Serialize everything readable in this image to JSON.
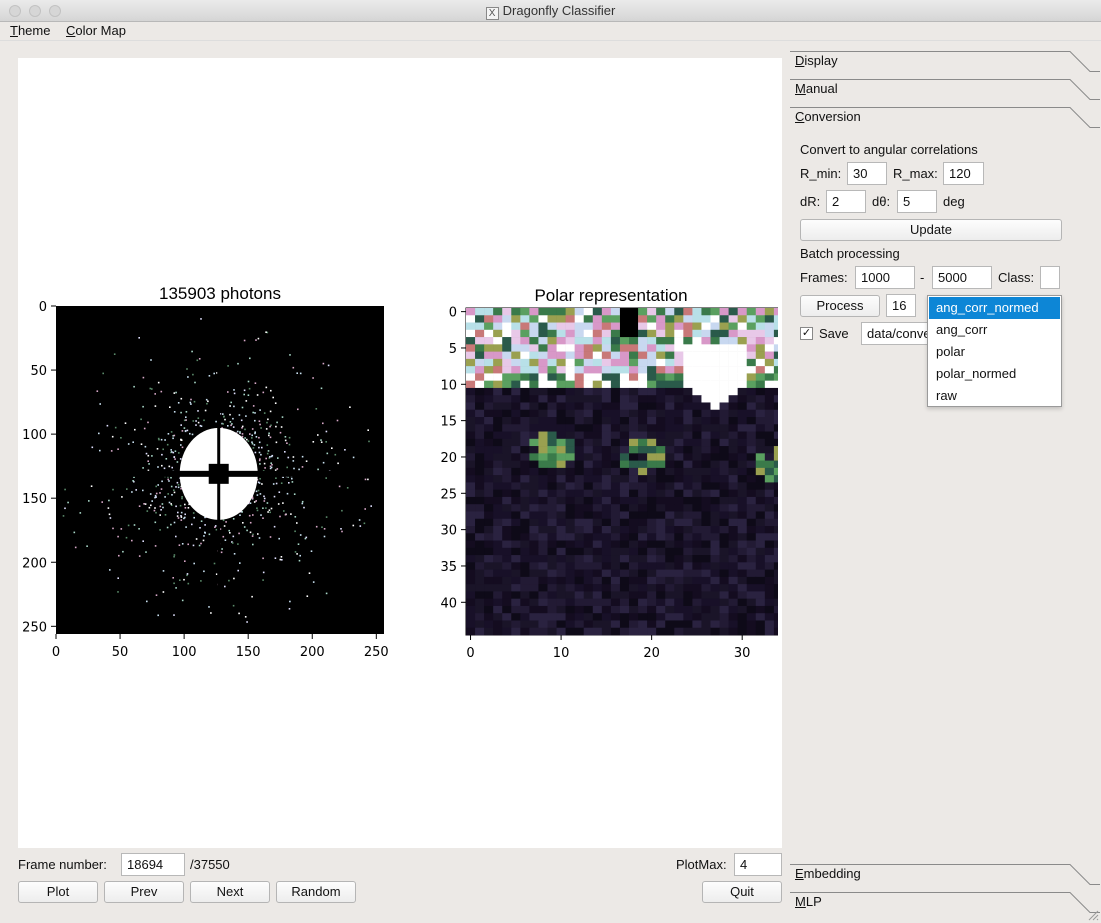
{
  "window": {
    "title": "Dragonfly Classifier"
  },
  "menu": {
    "theme": "Theme",
    "color_map": "Color Map"
  },
  "left_plot": {
    "title": "135903 photons",
    "x_ticks": [
      "0",
      "50",
      "100",
      "150",
      "200",
      "250"
    ],
    "y_ticks": [
      "0",
      "50",
      "100",
      "150",
      "200",
      "250"
    ],
    "xlim": [
      0,
      256
    ],
    "ylim": [
      256,
      0
    ]
  },
  "right_plot": {
    "title": "Polar representation",
    "x_ticks": [
      "0",
      "10",
      "20",
      "30"
    ],
    "y_ticks": [
      "0",
      "5",
      "10",
      "15",
      "20",
      "25",
      "30",
      "35",
      "40"
    ],
    "xlim": [
      0,
      36
    ],
    "ylim": [
      45,
      0
    ]
  },
  "colors": {
    "window_bg": "#ece9e6",
    "selected": "#0d86d6",
    "image_bg": "#000000"
  },
  "bottom": {
    "frame_label": "Frame number:",
    "frame_value": "18694",
    "frame_total": "/37550",
    "plotmax_label": "PlotMax:",
    "plotmax_value": "4",
    "buttons": {
      "plot": "Plot",
      "prev": "Prev",
      "next": "Next",
      "random": "Random",
      "quit": "Quit"
    }
  },
  "tabs": {
    "display": "Display",
    "manual": "Manual",
    "conversion": "Conversion",
    "embedding": "Embedding",
    "mlp": "MLP"
  },
  "conversion": {
    "heading": "Convert to angular correlations",
    "rmin_label": "R_min:",
    "rmin_value": "30",
    "rmax_label": "R_max:",
    "rmax_value": "120",
    "dr_label": "dR:",
    "dr_value": "2",
    "dtheta_label": "dθ:",
    "dtheta_value": "5",
    "deg_label": "deg",
    "update_button": "Update",
    "batch_heading": "Batch processing",
    "frames_label": "Frames:",
    "frames_start": "1000",
    "dash": "-",
    "frames_end": "5000",
    "class_label": "Class:",
    "class_value": "",
    "process_button": "Process",
    "threads_value": "16",
    "save_label": "Save",
    "save_checked": "✓",
    "save_path": "data/conve",
    "dropdown_options": [
      "ang_corr_normed",
      "ang_corr",
      "polar",
      "polar_normed",
      "raw"
    ],
    "dropdown_selected": "ang_corr_normed"
  }
}
